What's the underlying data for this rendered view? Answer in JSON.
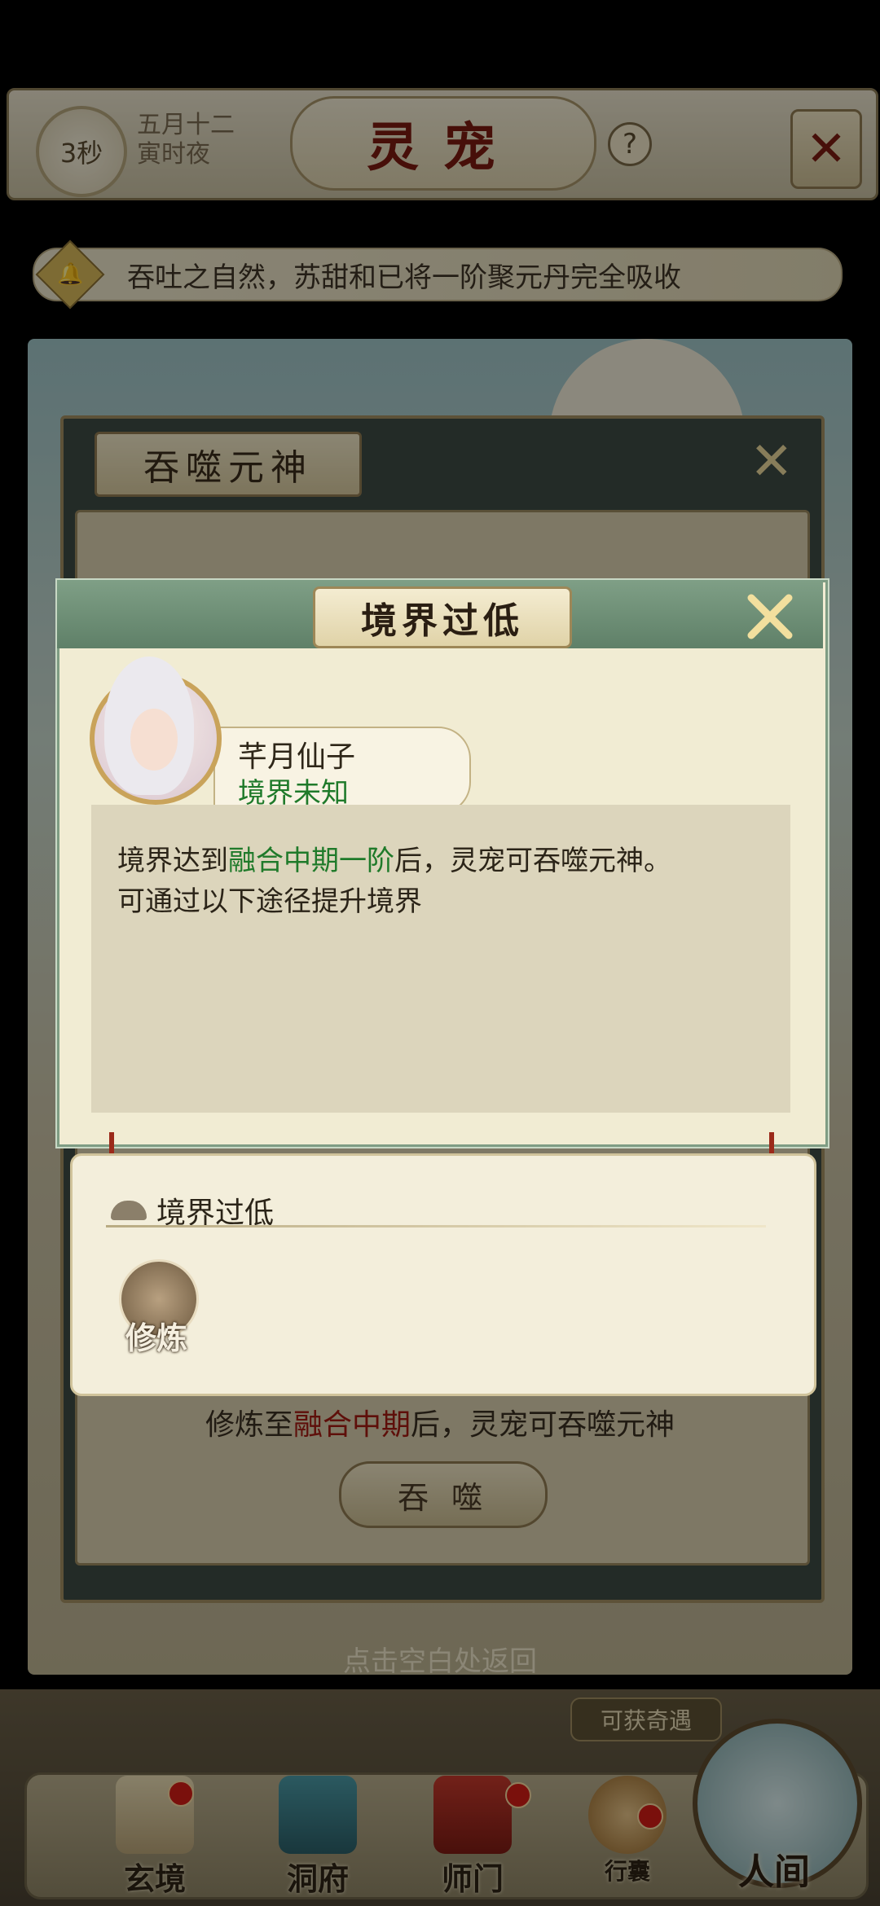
{
  "header": {
    "timer": "3秒",
    "date_line1": "五月十二",
    "date_line2": "寅时夜",
    "title": "灵宠",
    "help_symbol": "?",
    "close_symbol": "✕"
  },
  "notice": {
    "text": "吞吐之自然，苏甜和已将一阶聚元丹完全吸收",
    "icon": "bell-icon"
  },
  "devour_panel": {
    "title": "吞噬元神",
    "close_symbol": "✕",
    "hint_prefix": "修炼至",
    "hint_highlight": "融合中期",
    "hint_suffix": "后，灵宠可吞噬元神",
    "devour_button": "吞 噬"
  },
  "modal": {
    "title": "境界过低",
    "character_name": "芊月仙子",
    "character_realm": "境界未知",
    "message_prefix": "境界达到",
    "message_highlight": "融合中期一阶",
    "message_suffix": "后，灵宠可吞噬元神。",
    "message_line2": "可通过以下途径提升境界",
    "path_title": "境界过低",
    "path_item_label": "修炼"
  },
  "back_hint": "点击空白处返回",
  "bottom_nav": {
    "encounter_tag": "可获奇遇",
    "items": [
      {
        "label": "玄境",
        "icon": "scroll-icon"
      },
      {
        "label": "洞府",
        "icon": "pavilion-icon"
      },
      {
        "label": "师门",
        "icon": "banner-icon"
      },
      {
        "label": "行囊",
        "icon": "bag-icon"
      }
    ],
    "world_label": "人间"
  },
  "colors": {
    "highlight_green": "#1f7a2a",
    "highlight_red": "#a31a12",
    "modal_header": "#6f8f77"
  }
}
